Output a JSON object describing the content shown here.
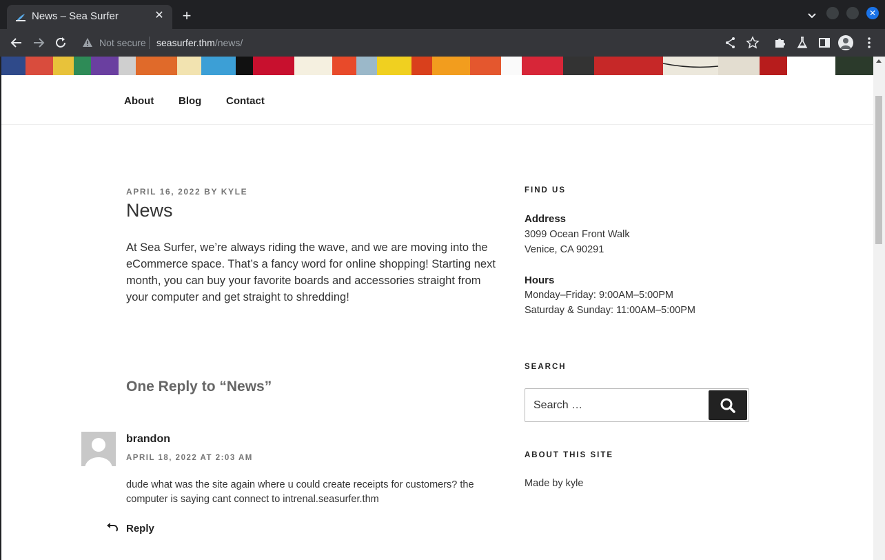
{
  "browser": {
    "tab_title": "News – Sea Surfer",
    "tab_close": "✕",
    "new_tab": "+",
    "security_label": "Not secure",
    "url_host": "seasurfer.thm",
    "url_path": "/news/"
  },
  "nav": {
    "items": [
      "About",
      "Blog",
      "Contact"
    ]
  },
  "post": {
    "date": "APRIL 16, 2022",
    "by": "BY",
    "author": "KYLE",
    "title": "News",
    "body": "At Sea Surfer, we’re always riding the wave, and we are moving into the eCommerce space. That’s a fancy word for online shopping! Starting next month, you can buy your favorite boards and accessories straight from your computer and get straight to shredding!"
  },
  "comments": {
    "title": "One Reply to “News”",
    "items": [
      {
        "author": "brandon",
        "date": "APRIL 18, 2022 AT 2:03 AM",
        "text": "dude what was the site again where u could create receipts for customers? the computer is saying cant connect to intrenal.seasurfer.thm",
        "reply_label": "Reply"
      }
    ]
  },
  "sidebar": {
    "find_us": {
      "title": "FIND US",
      "address_label": "Address",
      "address_line1": "3099 Ocean Front Walk",
      "address_line2": "Venice, CA 90291",
      "hours_label": "Hours",
      "hours_line1": "Monday–Friday: 9:00AM–5:00PM",
      "hours_line2": "Saturday & Sunday: 11:00AM–5:00PM"
    },
    "search": {
      "title": "SEARCH",
      "placeholder": "Search …"
    },
    "about": {
      "title": "ABOUT THIS SITE",
      "text": "Made by kyle"
    }
  },
  "colors": {
    "chrome_bg": "#202124",
    "toolbar_bg": "#35363a",
    "accent": "#1a73e8",
    "text_dark": "#222222",
    "meta_gray": "#767676"
  }
}
